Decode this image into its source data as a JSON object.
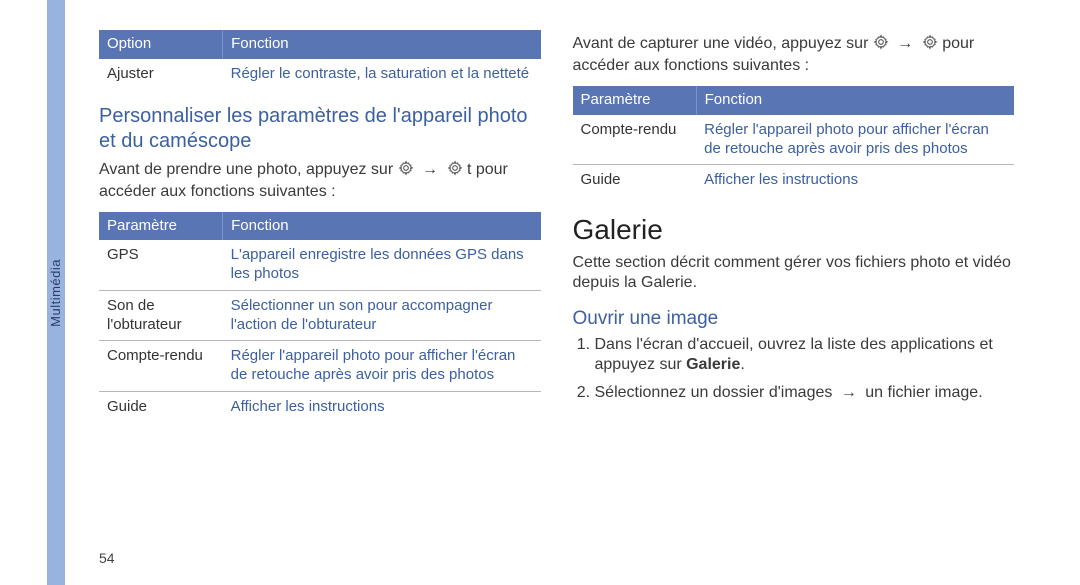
{
  "sidebar_label": "Multimédia",
  "page_number": "54",
  "arrow": "→",
  "left": {
    "table1": {
      "headers": [
        "Option",
        "Fonction"
      ],
      "rows": [
        {
          "c1": "Ajuster",
          "c2": "Régler le contraste, la saturation et la netteté"
        }
      ]
    },
    "heading1": "Personnaliser les paramètres de l'appareil photo et du caméscope",
    "intro_a": "Avant de prendre une photo, appuyez sur ",
    "intro_b": " t pour accéder aux fonctions suivantes :",
    "table2": {
      "headers": [
        "Paramètre",
        "Fonction"
      ],
      "rows": [
        {
          "c1": "GPS",
          "c2": "L'appareil enregistre les données GPS dans les photos"
        },
        {
          "c1": "Son de l'obturateur",
          "c2": "Sélectionner un son pour accompagner l'action de l'obturateur"
        },
        {
          "c1": "Compte-rendu",
          "c2": "Régler l'appareil photo pour afficher l'écran de retouche après avoir pris des photos"
        },
        {
          "c1": "Guide",
          "c2": "Afficher les instructions"
        }
      ]
    }
  },
  "right": {
    "intro_a": "Avant de capturer une vidéo, appuyez sur ",
    "intro_b": " pour accéder aux fonctions suivantes :",
    "table1": {
      "headers": [
        "Paramètre",
        "Fonction"
      ],
      "rows": [
        {
          "c1": "Compte-rendu",
          "c2": "Régler l'appareil photo pour afficher l'écran de retouche après avoir pris des photos"
        },
        {
          "c1": "Guide",
          "c2": "Afficher les instructions"
        }
      ]
    },
    "heading_major": "Galerie",
    "major_desc": "Cette section décrit comment gérer vos fichiers photo et vidéo depuis la Galerie.",
    "sub_heading": "Ouvrir une image",
    "step1_a": "Dans l'écran d'accueil, ouvrez la liste des applications et appuyez sur ",
    "step1_bold": "Galerie",
    "step1_b": ".",
    "step2_a": "Sélectionnez un dossier d'images ",
    "step2_b": " un fichier image."
  }
}
